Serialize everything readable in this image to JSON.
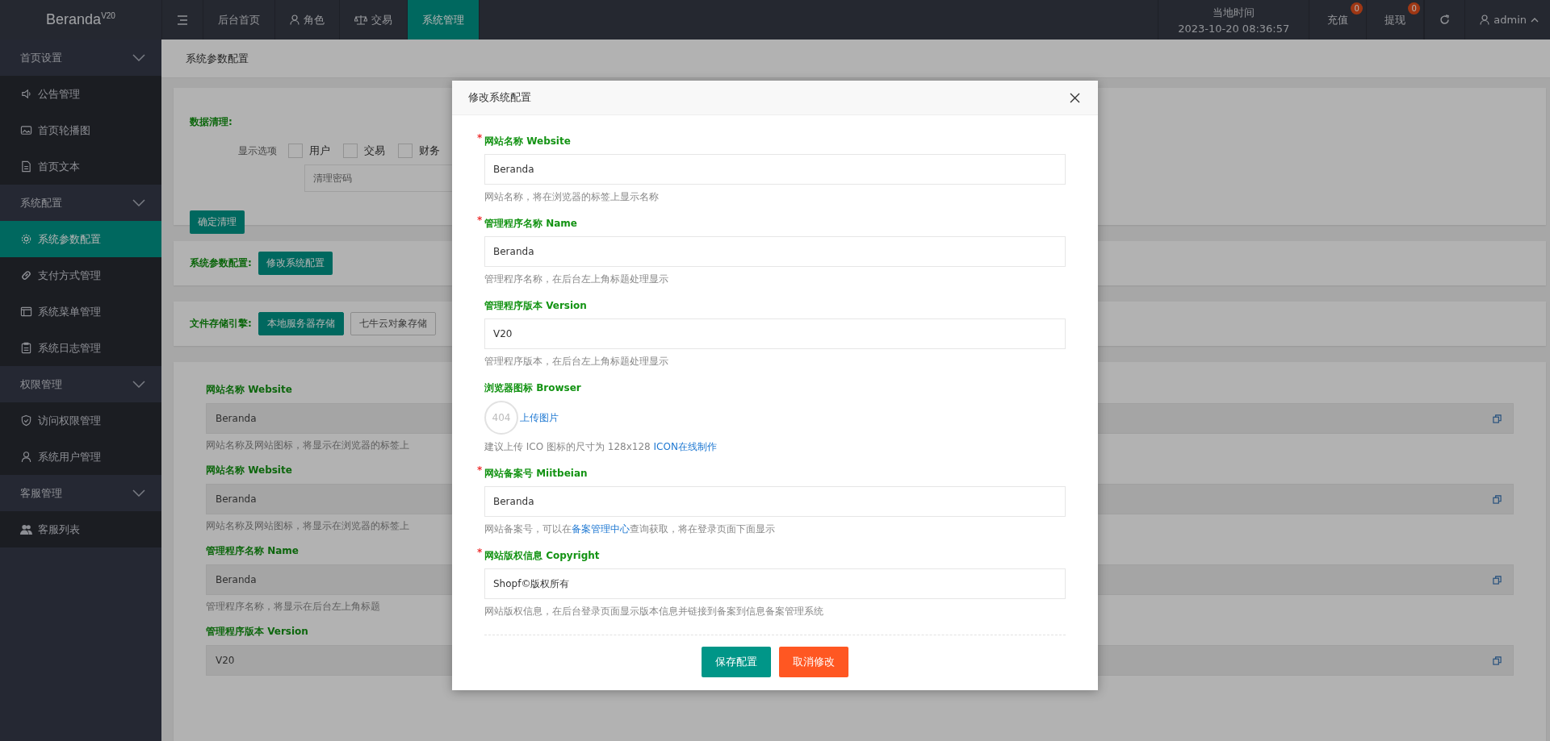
{
  "topbar": {
    "logo": "Beranda$^{V20}$",
    "nav": [
      {
        "label": "后台首页",
        "selected": false
      },
      {
        "label": "角色",
        "selected": false
      },
      {
        "label": "交易",
        "selected": false
      },
      {
        "label": "系统管理",
        "selected": true
      }
    ],
    "clock_label": "当地时间",
    "clock": "2023-10-20 08:36:57",
    "actions": [
      {
        "label": "充值",
        "badge": "0"
      },
      {
        "label": "提现",
        "badge": "0"
      }
    ],
    "user": "admin"
  },
  "sidebar": [
    {
      "label": "首页设置",
      "expanded": true,
      "items": [
        {
          "label": "公告管理",
          "selected": false
        },
        {
          "label": "首页轮播图",
          "selected": false
        },
        {
          "label": "首页文本",
          "selected": false
        }
      ]
    },
    {
      "label": "系统配置",
      "expanded": true,
      "items": [
        {
          "label": "系统参数配置",
          "selected": true
        },
        {
          "label": "支付方式管理",
          "selected": false
        },
        {
          "label": "系统菜单管理",
          "selected": false
        },
        {
          "label": "系统日志管理",
          "selected": false
        }
      ]
    },
    {
      "label": "权限管理",
      "expanded": true,
      "items": [
        {
          "label": "访问权限管理",
          "selected": false
        },
        {
          "label": "系统用户管理",
          "selected": false
        }
      ]
    },
    {
      "label": "客服管理",
      "expanded": true,
      "items": [
        {
          "label": "客服列表",
          "selected": false
        }
      ]
    }
  ],
  "breadcrumb": "系统参数配置",
  "cleanup": {
    "title": "数据清理:",
    "options_label": "显示选项",
    "options": [
      {
        "label": "用户",
        "checked": false
      },
      {
        "label": "交易",
        "checked": false
      },
      {
        "label": "财务",
        "checked": false
      }
    ],
    "password_placeholder": "清理密码",
    "button": "确定清理"
  },
  "config": {
    "title": "系统参数配置:",
    "button": "修改系统配置"
  },
  "storage": {
    "title": "文件存储引擎:",
    "engines": [
      {
        "label": "本地服务器存储",
        "selected": true
      },
      {
        "label": "七牛云对象存储",
        "selected": false
      }
    ]
  },
  "settings_fields": [
    {
      "label": "网站名称 Website",
      "value": "Beranda",
      "hint": "网站名称及网站图标，将显示在浏览器的标签上"
    },
    {
      "label": "网站名称 Website",
      "value": "Beranda",
      "hint": "网站名称及网站图标，将显示在浏览器的标签上"
    },
    {
      "label": "管理程序名称 Name",
      "value": "Beranda",
      "hint": "管理程序名称，将显示在后台左上角标题"
    },
    {
      "label": "管理程序版本 Version",
      "value": "V20"
    }
  ],
  "modal": {
    "title": "修改系统配置",
    "required_mark": "*",
    "fields": [
      {
        "kind": "text",
        "required": true,
        "label": "网站名称 Website",
        "value": "Beranda",
        "hint": "网站名称，将在浏览器的标签上显示名称"
      },
      {
        "kind": "text",
        "required": true,
        "label": "管理程序名称 Name",
        "value": "Beranda",
        "hint": "管理程序名称，在后台左上角标题处理显示"
      },
      {
        "kind": "text",
        "required": false,
        "label": "管理程序版本 Version",
        "value": "V20",
        "hint": "管理程序版本，在后台左上角标题处理显示"
      },
      {
        "kind": "image",
        "required": false,
        "label": "浏览器图标 Browser",
        "image_text": "404",
        "upload": "上传图片",
        "hint": "建议上传 ICO 图标的尺寸为 128x128 ",
        "hint_link": "ICON在线制作"
      },
      {
        "kind": "text",
        "required": true,
        "label": "网站备案号 Miitbeian",
        "value": "Beranda",
        "hint": "网站备案号，可以在",
        "hint_link": "备案管理中心",
        "hint_after": "查询获取，将在登录页面下面显示"
      },
      {
        "kind": "text",
        "required": true,
        "label": "网站版权信息 Copyright",
        "value": "Shopf©版权所有",
        "hint": "网站版权信息，在后台登录页面显示版本信息并链接到备案到信息备案管理系统"
      }
    ],
    "buttons": [
      {
        "label": "保存配置",
        "kind": "primary"
      },
      {
        "label": "取消修改",
        "kind": "danger"
      }
    ]
  }
}
